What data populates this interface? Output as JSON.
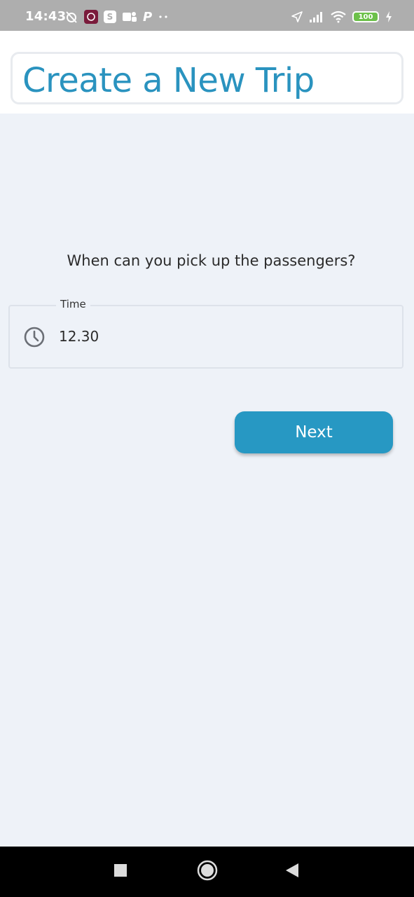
{
  "status_bar": {
    "time": "14:43",
    "battery": "100",
    "icons_left": [
      "alarm-off-icon",
      "app-badge-icon",
      "app-s-icon",
      "teams-icon",
      "p-icon",
      "more-dots-icon"
    ],
    "icons_right": [
      "location-icon",
      "signal-icon",
      "wifi-icon",
      "battery-icon",
      "charging-icon"
    ],
    "p_glyph": "P",
    "s_glyph": "S"
  },
  "header": {
    "title": "Create a New Trip",
    "title_color": "#2a93bf"
  },
  "main": {
    "question": "When can you pick up the passengers?",
    "time_field": {
      "label": "Time",
      "value": "12.30",
      "icon": "clock-icon"
    },
    "next_button": {
      "label": "Next",
      "color": "#2798c3"
    }
  },
  "nav_bar": {
    "buttons": [
      "recents-button",
      "home-button",
      "back-button"
    ]
  },
  "colors": {
    "background": "#eef2f8",
    "status_bar": "#aeaeae",
    "battery": "#6cc04a"
  }
}
